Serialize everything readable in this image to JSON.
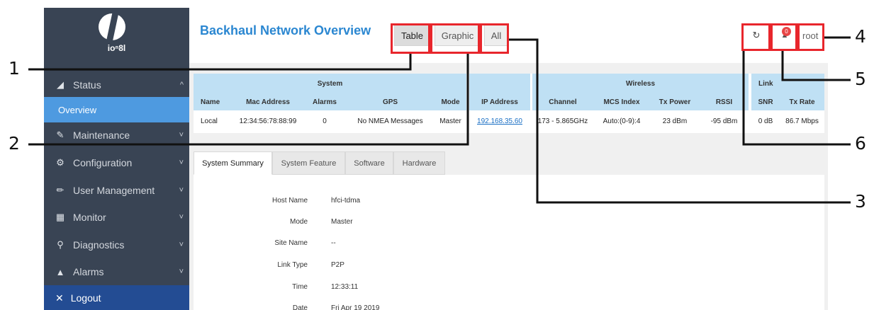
{
  "brand": {
    "logo_text": "ioⁿ8l"
  },
  "sidebar": {
    "items": [
      {
        "label": "Status",
        "icon": "bar-chart-icon",
        "glyph": "◢",
        "chevron": "^"
      },
      {
        "label": "Maintenance",
        "icon": "wrench-icon",
        "glyph": "✎",
        "chevron": "˅"
      },
      {
        "label": "Configuration",
        "icon": "gear-icon",
        "glyph": "⚙",
        "chevron": "˅"
      },
      {
        "label": "User Management",
        "icon": "pencil-icon",
        "glyph": "✏",
        "chevron": "˅"
      },
      {
        "label": "Monitor",
        "icon": "dashboard-icon",
        "glyph": "▦",
        "chevron": "˅"
      },
      {
        "label": "Diagnostics",
        "icon": "search-icon",
        "glyph": "⚲",
        "chevron": "˅"
      },
      {
        "label": "Alarms",
        "icon": "bell-icon",
        "glyph": "▲",
        "chevron": "˅"
      }
    ],
    "active_sub": "Overview",
    "logout": {
      "label": "Logout",
      "glyph": "✕"
    }
  },
  "header": {
    "title": "Backhaul Network Overview",
    "view_buttons": [
      "Table",
      "Graphic",
      "All"
    ],
    "active_view": "Table",
    "refresh_glyph": "↻",
    "bell_glyph": "▲",
    "alarm_count": "0",
    "user": "root"
  },
  "status_table": {
    "groups": [
      "System",
      "Wireless",
      "Link"
    ],
    "columns": [
      "Name",
      "Mac Address",
      "Alarms",
      "GPS",
      "Mode",
      "IP Address",
      "Channel",
      "MCS Index",
      "Tx Power",
      "RSSI",
      "SNR",
      "Tx Rate"
    ],
    "row": [
      "Local",
      "12:34:56:78:88:99",
      "0",
      "No NMEA Messages",
      "Master",
      "192.168.35.60",
      "173 - 5.865GHz",
      "Auto:(0-9):4",
      "23 dBm",
      "-95 dBm",
      "0 dB",
      "86.7 Mbps"
    ]
  },
  "detail_tabs": [
    "System Summary",
    "System Feature",
    "Software",
    "Hardware"
  ],
  "summary": [
    {
      "key": "Host Name",
      "value": "hfci-tdma"
    },
    {
      "key": "Mode",
      "value": "Master"
    },
    {
      "key": "Site Name",
      "value": "--"
    },
    {
      "key": "Link Type",
      "value": "P2P"
    },
    {
      "key": "Time",
      "value": "12:33:11"
    },
    {
      "key": "Date",
      "value": "Fri Apr 19 2019"
    }
  ],
  "callouts": [
    "1",
    "2",
    "3",
    "4",
    "5",
    "6"
  ],
  "colors": {
    "highlight": "#e8262c",
    "accent": "#2b87d1",
    "sidebar": "#394454",
    "active_nav": "#4e9ae0",
    "logout": "#234c93",
    "table_header": "#bfe0f4"
  }
}
